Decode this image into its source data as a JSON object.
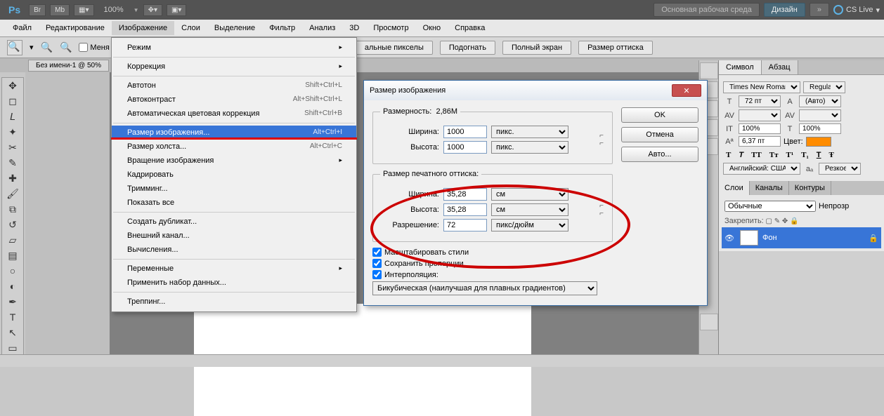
{
  "appbar": {
    "zoom": "100%",
    "workspace_default": "Основная рабочая среда",
    "workspace_active": "Дизайн",
    "cslive": "CS Live"
  },
  "menu": {
    "file": "Файл",
    "edit": "Редактирование",
    "image": "Изображение",
    "layer": "Слои",
    "select": "Выделение",
    "filter": "Фильтр",
    "analysis": "Анализ",
    "threed": "3D",
    "view": "Просмотр",
    "window": "Окно",
    "help": "Справка"
  },
  "opt": {
    "chk1": "Меня",
    "real_px": "альные пикселы",
    "fit": "Подогнать",
    "full": "Полный экран",
    "print": "Размер оттиска"
  },
  "doctab": "Без имени-1 @ 50%",
  "dd": {
    "mode": "Режим",
    "adjust": "Коррекция",
    "autotone": "Автотон",
    "autotone_sc": "Shift+Ctrl+L",
    "autocontrast": "Автоконтраст",
    "autocontrast_sc": "Alt+Shift+Ctrl+L",
    "autocolor": "Автоматическая цветовая коррекция",
    "autocolor_sc": "Shift+Ctrl+B",
    "imgsize": "Размер изображения...",
    "imgsize_sc": "Alt+Ctrl+I",
    "canvassize": "Размер холста...",
    "canvassize_sc": "Alt+Ctrl+C",
    "rotate": "Вращение изображения",
    "crop": "Кадрировать",
    "trim": "Тримминг...",
    "reveal": "Показать все",
    "dup": "Создать дубликат...",
    "extchan": "Внешний канал...",
    "calc": "Вычисления...",
    "vars": "Переменные",
    "apply": "Применить набор данных...",
    "trap": "Треппинг..."
  },
  "dlg": {
    "title": "Размер изображения",
    "dim_legend": "Размерность:",
    "dim_value": "2,86M",
    "width_l": "Ширина:",
    "height_l": "Высота:",
    "px_w": "1000",
    "px_h": "1000",
    "unit_px": "пикс.",
    "print_legend": "Размер печатного оттиска:",
    "prt_w": "35,28",
    "prt_h": "35,28",
    "unit_cm": "см",
    "res_l": "Разрешение:",
    "res_v": "72",
    "unit_res": "пикс/дюйм",
    "scale_styles": "Масштабировать стили",
    "constrain": "Сохранить пропорции",
    "resample": "Интерполяция:",
    "interp_opt": "Бикубическая (наилучшая для плавных градиентов)",
    "ok": "OK",
    "cancel": "Отмена",
    "auto": "Авто..."
  },
  "panels": {
    "symbol": "Символ",
    "para": "Абзац",
    "font": "Times New Roman",
    "style": "Regular",
    "size": "72 пт",
    "leading": "(Авто)",
    "tracking100a": "100%",
    "tracking100b": "100%",
    "baseline": "6,37 пт",
    "color_l": "Цвет:",
    "lang": "Английский: США",
    "aa": "Резкое",
    "layers": "Слои",
    "channels": "Каналы",
    "paths": "Контуры",
    "blend": "Обычные",
    "opacity_l": "Непрозр",
    "lock_l": "Закрепить:",
    "bg_layer": "Фон"
  }
}
